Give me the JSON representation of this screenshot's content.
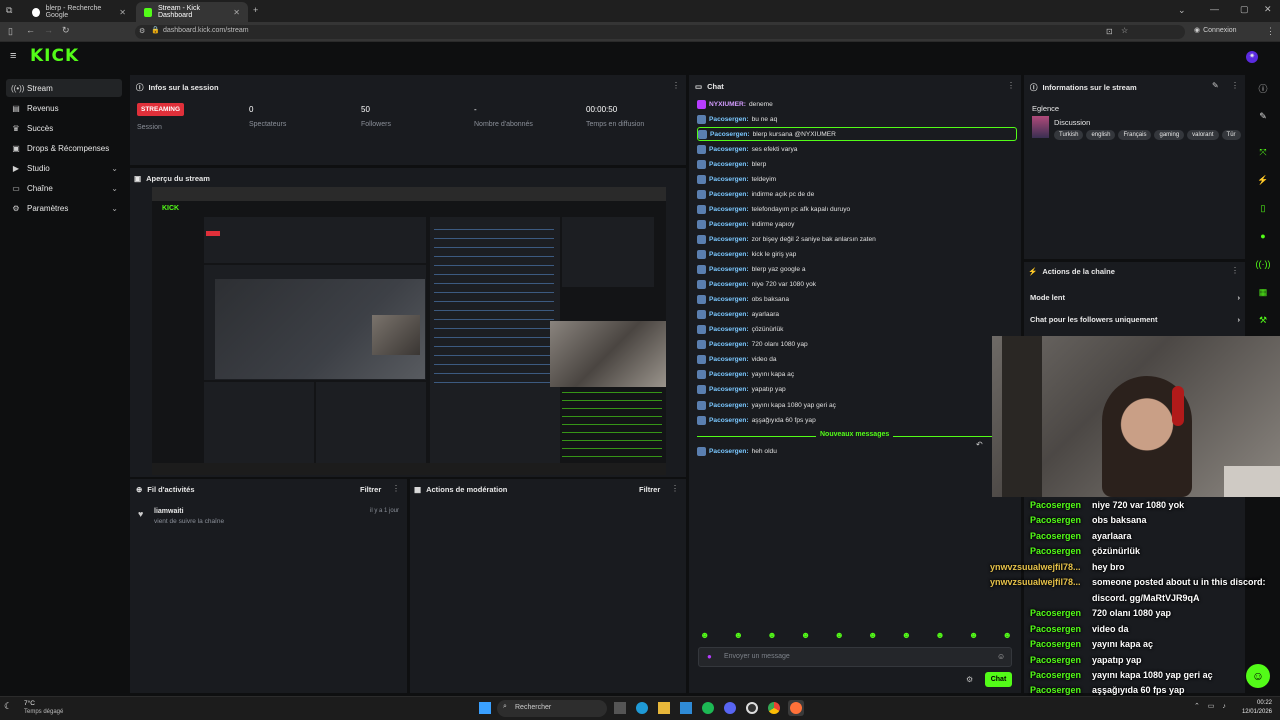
{
  "browser": {
    "tabs": [
      {
        "title": "blerp - Recherche Google"
      },
      {
        "title": "Stream - Kick Dashboard"
      }
    ],
    "url": "dashboard.kick.com/stream",
    "profile_label": "Connexion"
  },
  "brand": {
    "logo": "KICK",
    "accent": "#53fc18"
  },
  "sidebar": {
    "items": [
      {
        "label": "Stream",
        "icon": "broadcast-icon"
      },
      {
        "label": "Revenus",
        "icon": "wallet-icon"
      },
      {
        "label": "Succès",
        "icon": "trophy-icon"
      },
      {
        "label": "Drops & Récompenses",
        "icon": "gift-icon"
      },
      {
        "label": "Studio",
        "icon": "video-icon"
      },
      {
        "label": "Chaîne",
        "icon": "channel-icon"
      },
      {
        "label": "Paramètres",
        "icon": "gear-icon"
      }
    ]
  },
  "session": {
    "title": "Infos sur la session",
    "status_badge": "STREAMING",
    "status_label": "Session",
    "stats": [
      {
        "value": "0",
        "label": "Spectateurs"
      },
      {
        "value": "50",
        "label": "Followers"
      },
      {
        "value": "-",
        "label": "Nombre d'abonnés"
      },
      {
        "value": "00:00:50",
        "label": "Temps en diffusion"
      }
    ]
  },
  "preview": {
    "title": "Aperçu du stream"
  },
  "activity": {
    "title": "Fil d'activités",
    "filter": "Filtrer",
    "items": [
      {
        "user": "liamwaiti",
        "text": "vient de suivre la chaîne",
        "time": "il y a 1 jour"
      }
    ]
  },
  "moderation": {
    "title": "Actions de modération",
    "filter": "Filtrer"
  },
  "chat": {
    "title": "Chat",
    "messages": [
      {
        "user": "NYXIUMER:",
        "text": "deneme"
      },
      {
        "user": "Pacosergen:",
        "text": "bu ne aq"
      },
      {
        "user": "Pacosergen:",
        "text": "blerp kursana @NYXIUMER"
      },
      {
        "user": "Pacosergen:",
        "text": "ses efekti varya"
      },
      {
        "user": "Pacosergen:",
        "text": "blerp"
      },
      {
        "user": "Pacosergen:",
        "text": "teldeyim"
      },
      {
        "user": "Pacosergen:",
        "text": "indirme açık pc de de"
      },
      {
        "user": "Pacosergen:",
        "text": "telefondayım pc afk kapalı duruyo"
      },
      {
        "user": "Pacosergen:",
        "text": "indirme yapıoy"
      },
      {
        "user": "Pacosergen:",
        "text": "zor bişey değil 2 saniye bak anlarsın zaten"
      },
      {
        "user": "Pacosergen:",
        "text": "kick le giriş yap"
      },
      {
        "user": "Pacosergen:",
        "text": "blerp yaz google a"
      },
      {
        "user": "Pacosergen:",
        "text": "niye 720 var 1080 yok"
      },
      {
        "user": "Pacosergen:",
        "text": "obs baksana"
      },
      {
        "user": "Pacosergen:",
        "text": "ayarlaara"
      },
      {
        "user": "Pacosergen:",
        "text": "çözünürlük"
      },
      {
        "user": "Pacosergen:",
        "text": "720 olanı 1080 yap"
      },
      {
        "user": "Pacosergen:",
        "text": "video da"
      },
      {
        "user": "Pacosergen:",
        "text": "yayını kapa aç"
      },
      {
        "user": "Pacosergen:",
        "text": "yapatıp yap"
      },
      {
        "user": "Pacosergen:",
        "text": "yayını kapa 1080 yap geri aç"
      },
      {
        "user": "Pacosergen:",
        "text": "aşşağıyıda 60 fps yap"
      }
    ],
    "new_messages_label": "Nouveaux messages",
    "after_divider": {
      "user": "Pacosergen:",
      "text": "heh oldu"
    },
    "input_placeholder": "Envoyer un message",
    "send_label": "Chat"
  },
  "stream_info": {
    "title": "Informations sur le stream",
    "stream_title": "Eglence",
    "category": "Discussion",
    "tags": [
      "Turkish",
      "english",
      "Français",
      "gaming",
      "valorant",
      "Tür"
    ]
  },
  "channel_actions": {
    "title": "Actions de la chaîne",
    "items": [
      {
        "label": "Mode lent"
      },
      {
        "label": "Chat pour les followers uniquement"
      }
    ]
  },
  "overlay_chat": [
    {
      "user": "Pacosergen",
      "text": "niye 720 var 1080 yok",
      "style": "u"
    },
    {
      "user": "Pacosergen",
      "text": "obs baksana",
      "style": "u"
    },
    {
      "user": "Pacosergen",
      "text": "ayarlaara",
      "style": "u"
    },
    {
      "user": "Pacosergen",
      "text": "çözünürlük",
      "style": "u"
    },
    {
      "user": "ynwvzsuualwejfil78...",
      "text": "hey bro",
      "style": "u2"
    },
    {
      "user": "ynwvzsuualwejfil78...",
      "text": "someone posted about u in this discord:",
      "style": "u2"
    },
    {
      "user": "",
      "text": "discord. gg/MaRtVJR9qA",
      "style": "u2"
    },
    {
      "user": "Pacosergen",
      "text": "720 olanı 1080 yap",
      "style": "u"
    },
    {
      "user": "Pacosergen",
      "text": "video da",
      "style": "u"
    },
    {
      "user": "Pacosergen",
      "text": "yayını kapa aç",
      "style": "u"
    },
    {
      "user": "Pacosergen",
      "text": "yapatıp yap",
      "style": "u"
    },
    {
      "user": "Pacosergen",
      "text": "yayını kapa 1080 yap geri aç",
      "style": "u"
    },
    {
      "user": "Pacosergen",
      "text": "aşşağıyıda 60 fps yap",
      "style": "u"
    },
    {
      "user": "Pacosergen",
      "text": "heh oldu",
      "style": "u"
    }
  ],
  "taskbar": {
    "weather_temp": "7°C",
    "weather_desc": "Temps dégagé",
    "search_placeholder": "Rechercher",
    "time": "00:22",
    "date": "12/01/2026"
  }
}
